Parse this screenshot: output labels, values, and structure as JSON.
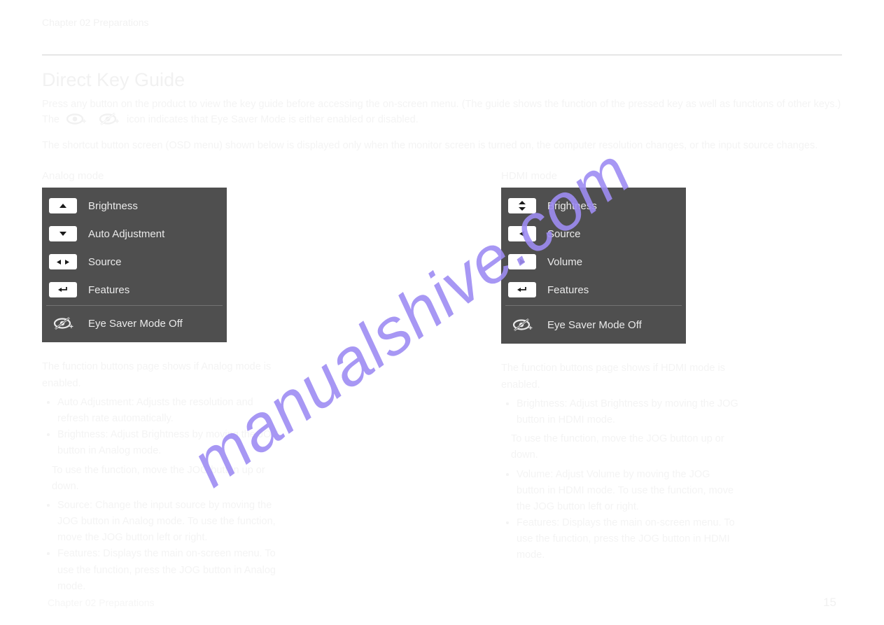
{
  "chapter": "Chapter 02   Preparations",
  "section_title": "Direct Key Guide",
  "intro_prefix": "Press any button on the product to view the key guide before accessing the on-screen menu. (The guide shows the function of the pressed key as well as functions of other keys.) The ",
  "intro_suffix": " icon indicates that Eye Saver Mode is either enabled or disabled.",
  "footnote": "The shortcut button screen (OSD menu) shown below is displayed only when the monitor screen is turned on, the computer resolution changes, or the input source changes.",
  "analog_label": "Analog mode",
  "analog_items": [
    "Brightness",
    "Auto Adjustment",
    "Source",
    "Features"
  ],
  "hdmi_label": "HDMI mode",
  "hdmi_items": [
    "Brightness",
    "Source",
    "Volume",
    "Features"
  ],
  "eye_saver_off": "Eye Saver Mode Off",
  "notes_analog_title": "The function buttons page shows if Analog mode is enabled.",
  "notes_analog": [
    "Auto Adjustment: Adjusts the resolution and refresh rate automatically.",
    "Brightness: Adjust Brightness by moving the JOG button in Analog mode.",
    "To use the function, move the JOG button up or down.",
    "Source: Change the input source by moving the JOG button in Analog mode. To use the function, move the JOG button left or right.",
    "Features: Displays the main on-screen menu. To use the function, press the JOG button in Analog mode."
  ],
  "notes_hdmi_title": "The function buttons page shows if HDMI mode is enabled.",
  "notes_hdmi": [
    "Brightness: Adjust Brightness by moving the JOG button in HDMI mode.",
    "To use the function, move the JOG button up or down.",
    "Volume: Adjust Volume by moving the JOG button in HDMI mode. To use the function, move the JOG button left or right.",
    "Features: Displays the main on-screen menu. To use the function, press the JOG button in HDMI mode."
  ],
  "page_number": "15",
  "watermark": "manualshive.com"
}
